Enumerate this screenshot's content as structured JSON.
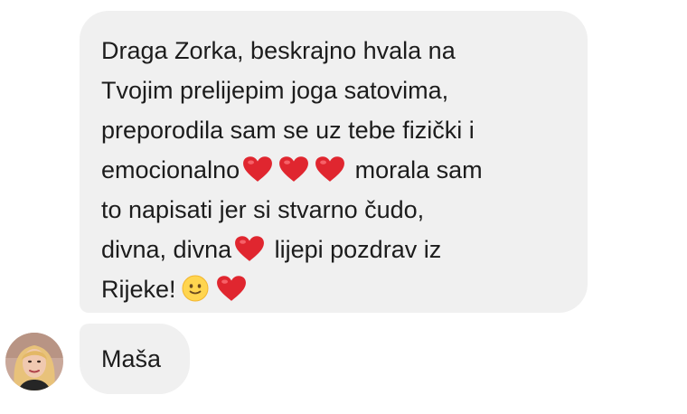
{
  "message": {
    "line1": "Draga Zorka, beskrajno hvala na",
    "line2": "Tvojim prelijepim joga satovima,",
    "line3": "preporodila sam se uz tebe fizički i",
    "line4a": "emocionalno",
    "line4b": "morala sam",
    "line5": "to napisati jer si stvarno čudo,",
    "line6a": "divna, divna",
    "line6b": "lijepi pozdrav iz",
    "line7": "Rijeke!",
    "emojis": [
      "red-heart",
      "smiling-face"
    ]
  },
  "sender": {
    "name": "Maša",
    "avatar": "profile-photo"
  },
  "colors": {
    "bubble": "#f0f0f0",
    "text": "#1c1c1c",
    "heart": "#e0262f"
  }
}
